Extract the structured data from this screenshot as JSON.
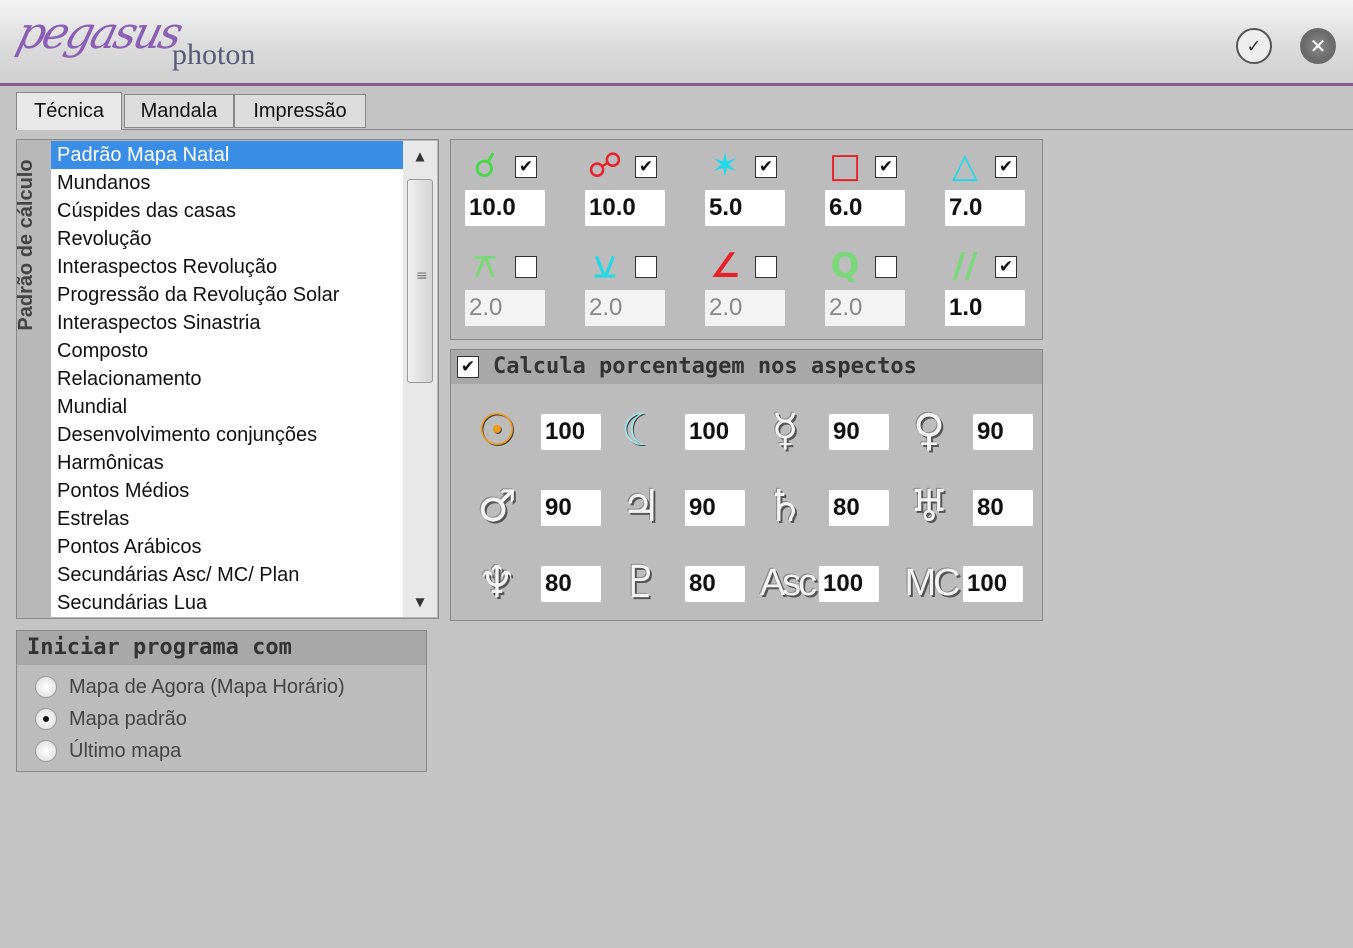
{
  "app": {
    "logo_script": "pegasus",
    "logo_name": "photon",
    "ok_icon": "check-circle-icon",
    "close_icon": "x-circle-icon"
  },
  "tabs": [
    {
      "label": "Técnica"
    },
    {
      "label": "Mandala"
    },
    {
      "label": "Impressão"
    }
  ],
  "calc": {
    "title": "Padrão de cálculo",
    "items": [
      "Padrão Mapa Natal",
      "Mundanos",
      "Cúspides das casas",
      "Revolução",
      "Interaspectos Revolução",
      "Progressão da Revolução Solar",
      "Interaspectos Sinastria",
      "Composto",
      "Relacionamento",
      "Mundial",
      "Desenvolvimento conjunções",
      "Harmônicas",
      "Pontos Médios",
      "Estrelas",
      "Pontos Arábicos",
      "Secundárias Asc/ MC/ Plan",
      "Secundárias Lua"
    ],
    "selected": "Padrão Mapa Natal"
  },
  "aspects": [
    {
      "glyph": "☌",
      "color": "#4ed64e",
      "checked": true,
      "orb": "10.0",
      "enabled": true
    },
    {
      "glyph": "☍",
      "color": "#e8202a",
      "checked": true,
      "orb": "10.0",
      "enabled": true
    },
    {
      "glyph": "✶",
      "color": "#24d8e8",
      "checked": true,
      "orb": "5.0",
      "enabled": true
    },
    {
      "glyph": "□",
      "color": "#e8202a",
      "checked": true,
      "orb": "6.0",
      "enabled": true
    },
    {
      "glyph": "△",
      "color": "#24d8e8",
      "checked": true,
      "orb": "7.0",
      "enabled": true
    },
    {
      "glyph": "⚻",
      "color": "#7ad87a",
      "checked": false,
      "orb": "2.0",
      "enabled": false
    },
    {
      "glyph": "⚺",
      "color": "#24d8e8",
      "checked": false,
      "orb": "2.0",
      "enabled": false
    },
    {
      "glyph": "∠",
      "color": "#e8202a",
      "checked": false,
      "orb": "2.0",
      "enabled": false
    },
    {
      "glyph": "Q",
      "color": "#7ad87a",
      "checked": false,
      "orb": "2.0",
      "enabled": false
    },
    {
      "glyph": "//",
      "color": "#7ad87a",
      "checked": true,
      "orb": "1.0",
      "enabled": true
    }
  ],
  "percent": {
    "checked": true,
    "title": "Calcula porcentagem nos aspectos",
    "planets": [
      {
        "name": "sun",
        "glyph": "☉",
        "value": "100"
      },
      {
        "name": "moon",
        "glyph": "☾",
        "value": "100"
      },
      {
        "name": "mercury",
        "glyph": "☿",
        "value": "90"
      },
      {
        "name": "venus",
        "glyph": "♀",
        "value": "90"
      },
      {
        "name": "mars",
        "glyph": "♂",
        "value": "90"
      },
      {
        "name": "jupiter",
        "glyph": "♃",
        "value": "90"
      },
      {
        "name": "saturn",
        "glyph": "♄",
        "value": "80"
      },
      {
        "name": "uranus",
        "glyph": "♅",
        "value": "80"
      },
      {
        "name": "neptune",
        "glyph": "♆",
        "value": "80"
      },
      {
        "name": "pluto",
        "glyph": "♇",
        "value": "80"
      },
      {
        "name": "asc",
        "glyph": "Asc",
        "value": "100"
      },
      {
        "name": "mc",
        "glyph": "MC",
        "value": "100"
      }
    ]
  },
  "start": {
    "title": "Iniciar programa com",
    "options": [
      {
        "label": "Mapa de Agora (Mapa Horário)",
        "selected": false
      },
      {
        "label": "Mapa padrão",
        "selected": true
      },
      {
        "label": "Último mapa",
        "selected": false
      }
    ]
  }
}
